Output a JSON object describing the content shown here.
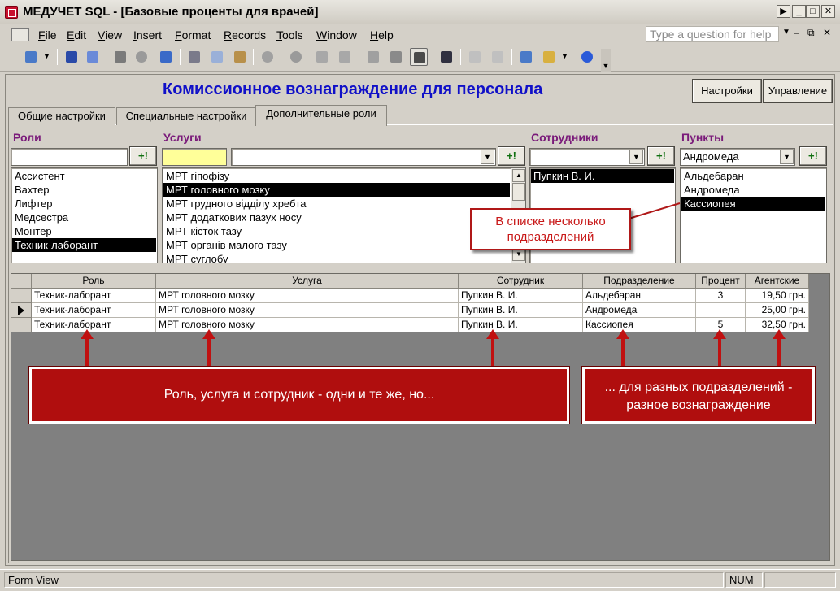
{
  "window": {
    "title": "МЕДУЧЕТ SQL - [Базовые проценты для врачей]"
  },
  "menu": {
    "items": [
      "File",
      "Edit",
      "View",
      "Insert",
      "Format",
      "Records",
      "Tools",
      "Window",
      "Help"
    ],
    "help_placeholder": "Type a question for help"
  },
  "form": {
    "title": "Комиссионное вознаграждение для персонала",
    "settings_button": "Настройки",
    "control_button": "Управление"
  },
  "tabs": [
    "Общие настройки",
    "Специальные настройки",
    "Дополнительные роли"
  ],
  "sections": {
    "roles": "Роли",
    "services": "Услуги",
    "employees": "Сотрудники",
    "points": "Пункты"
  },
  "add_button": "+!",
  "roles_list": [
    "Ассистент",
    "Вахтер",
    "Лифтер",
    "Медсестра",
    "Монтер",
    "Техник-лаборант"
  ],
  "services_list": [
    "МРТ гіпофізу",
    "МРТ головного мозку",
    "МРТ грудного відділу хребта",
    "МРТ додаткових пазух носу",
    "МРТ кісток тазу",
    "МРТ органів малого тазу",
    "МРТ суглобу"
  ],
  "employees_list": [
    "Пупкин В. И."
  ],
  "points_combo": "Андромеда",
  "points_list": [
    "Альдебаран",
    "Андромеда",
    "Кассиопея"
  ],
  "grid": {
    "headers": [
      "Роль",
      "Услуга",
      "Сотрудник",
      "Подразделение",
      "Процент",
      "Агентские"
    ],
    "rows": [
      [
        "Техник-лаборант",
        "МРТ головного мозку",
        "Пупкин В. И.",
        "Альдебаран",
        "3",
        "19,50 грн."
      ],
      [
        "Техник-лаборант",
        "МРТ головного мозку",
        "Пупкин В. И.",
        "Андромеда",
        "",
        "25,00 грн."
      ],
      [
        "Техник-лаборант",
        "МРТ головного мозку",
        "Пупкин В. И.",
        "Кассиопея",
        "5",
        "32,50 грн."
      ]
    ]
  },
  "callouts": {
    "list_note": "В списке несколько подразделений",
    "left_note": "Роль, услуга и сотрудник - одни и те же, но...",
    "right_note": "... для разных подразделений - разное вознаграждение"
  },
  "status": {
    "view": "Form View",
    "num": "NUM"
  }
}
